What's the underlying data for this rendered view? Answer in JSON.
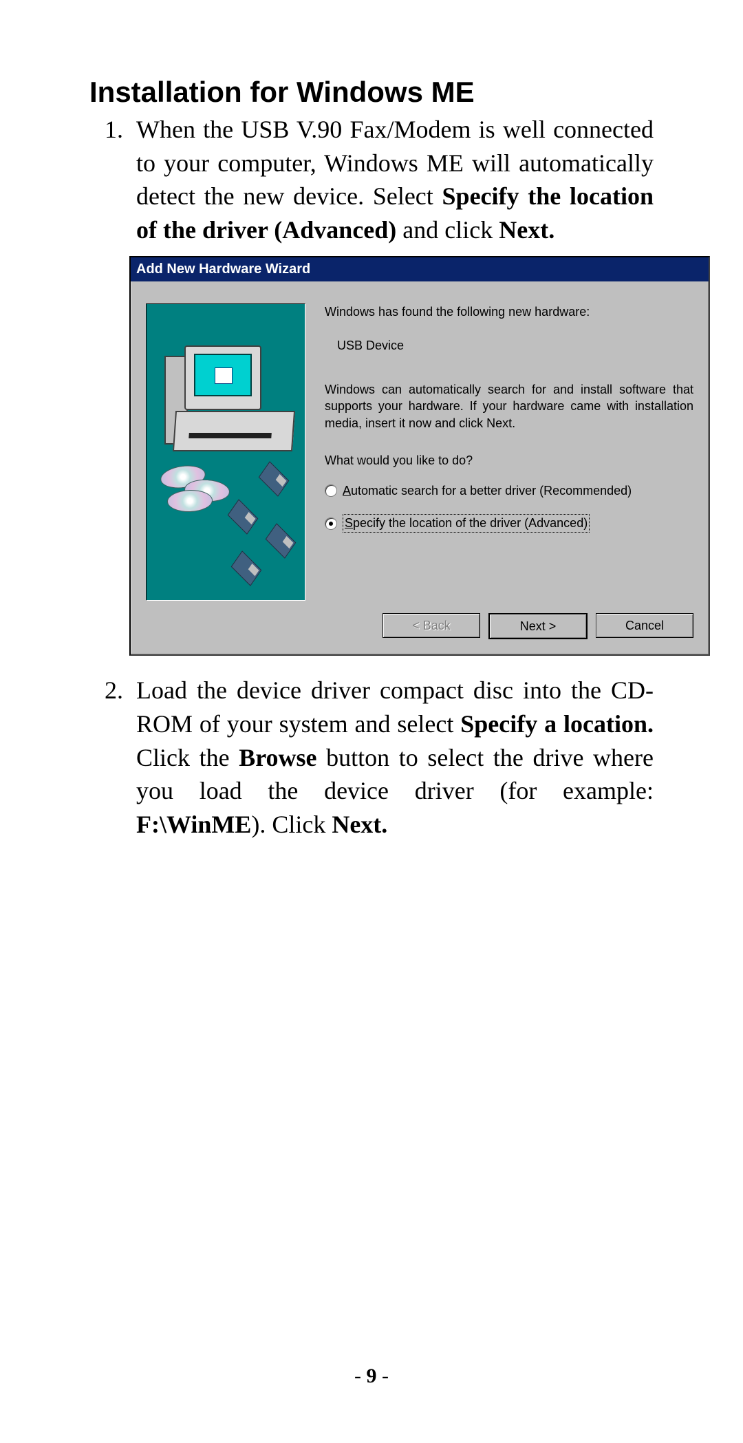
{
  "heading": "Installation for Windows ME",
  "steps": {
    "s1_a": "When the USB V.90 Fax/Modem is well connected to your computer, Windows ME will automatically detect the new device. Select ",
    "s1_b": "Specify the location of the driver (Advanced)",
    "s1_c": " and click ",
    "s1_d": "Next.",
    "s2_a": "Load the device driver compact disc into the CD-ROM of your system and select ",
    "s2_b": "Specify a location.",
    "s2_c": " Click the ",
    "s2_d": "Browse",
    "s2_e": " button to select the drive where you load the device driver (for example: ",
    "s2_f": "F:\\WinME",
    "s2_g": ").  Click ",
    "s2_h": "Next."
  },
  "dialog": {
    "title": "Add New Hardware Wizard",
    "found": "Windows has found the following new hardware:",
    "device": "USB Device",
    "desc": "Windows can automatically search for and install software that supports your hardware. If your hardware came with installation media, insert it now and click Next.",
    "prompt": "What would you like to do?",
    "opt1_pre": "A",
    "opt1_rest": "utomatic search for a better driver (Recommended)",
    "opt2_pre": "S",
    "opt2_rest": "pecify the location of the driver (Advanced)",
    "back": "< Back",
    "next": "Next >",
    "cancel": "Cancel"
  },
  "page_number": "- 9 -"
}
